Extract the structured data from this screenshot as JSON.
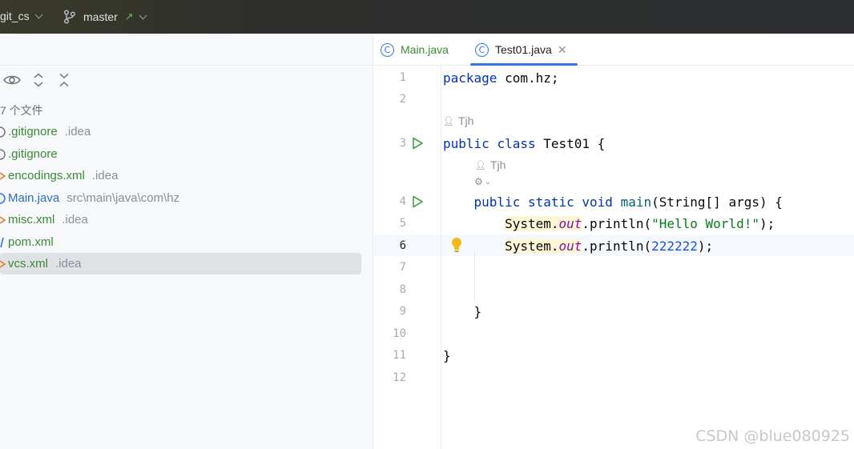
{
  "topbar": {
    "project": "git_cs",
    "branch": "master"
  },
  "left_panel": {
    "files_count": "7 个文件",
    "files": [
      {
        "name": ".gitignore",
        "path": ".idea",
        "icon": "file-icon"
      },
      {
        "name": ".gitignore",
        "path": "",
        "icon": "file-icon"
      },
      {
        "name": "encodings.xml",
        "path": ".idea",
        "icon": "xml-icon"
      },
      {
        "name": "Main.java",
        "path": "src\\main\\java\\com\\hz",
        "icon": "java-class-icon"
      },
      {
        "name": "misc.xml",
        "path": ".idea",
        "icon": "xml-icon"
      },
      {
        "name": "pom.xml",
        "path": "",
        "icon": "maven-icon"
      },
      {
        "name": "vcs.xml",
        "path": ".idea",
        "icon": "xml-icon",
        "selected": true
      }
    ]
  },
  "editor": {
    "tabs": [
      {
        "label": "Main.java",
        "active": false
      },
      {
        "label": "Test01.java",
        "active": true
      }
    ],
    "author_hint": "Tjh",
    "line_numbers": [
      "1",
      "2",
      "3",
      "4",
      "5",
      "6",
      "7",
      "8",
      "9",
      "10",
      "11",
      "12"
    ],
    "code": {
      "l1_kw": "package",
      "l1_rest": " com.hz;",
      "l3_kw1": "public",
      "l3_kw2": "class",
      "l3_rest": " Test01 {",
      "l4_kw1": "public",
      "l4_kw2": "static",
      "l4_kw3": "void",
      "l4_fn": "main",
      "l4_rest": "(String[] args) {",
      "l5_obj": "System.",
      "l5_fld": "out",
      "l5_call": ".println(",
      "l5_str": "\"Hello World!\"",
      "l5_end": ");",
      "l6_obj": "System.",
      "l6_fld": "out",
      "l6_call": ".println(",
      "l6_num": "222222",
      "l6_end": ");",
      "l9": "}",
      "l11": "}"
    }
  },
  "watermark": "CSDN @blue080925"
}
